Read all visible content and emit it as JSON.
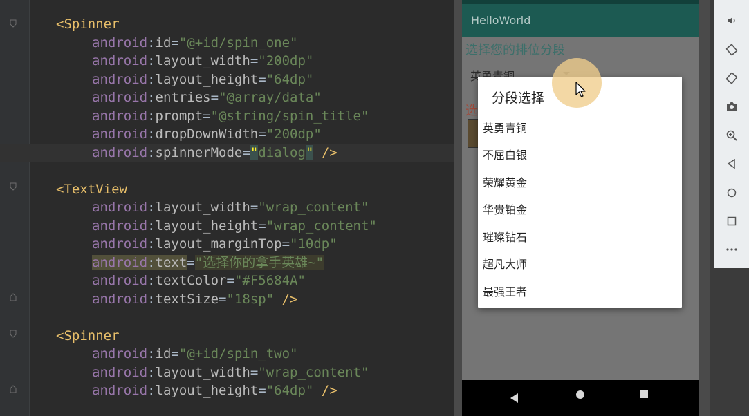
{
  "editor": {
    "lines": [
      {
        "kind": "open",
        "tag": "<Spinner"
      },
      {
        "kind": "attr",
        "ns": "android",
        "name": "id",
        "value": "\"@+id/spin_one\""
      },
      {
        "kind": "attr",
        "ns": "android",
        "name": "layout_width",
        "value": "\"200dp\""
      },
      {
        "kind": "attr",
        "ns": "android",
        "name": "layout_height",
        "value": "\"64dp\""
      },
      {
        "kind": "attr",
        "ns": "android",
        "name": "entries",
        "value": "\"@array/data\""
      },
      {
        "kind": "attr",
        "ns": "android",
        "name": "prompt",
        "value": "\"@string/spin_title\""
      },
      {
        "kind": "attr",
        "ns": "android",
        "name": "dropDownWidth",
        "value": "\"200dp\""
      },
      {
        "kind": "attr",
        "ns": "android",
        "name": "spinnerMode",
        "q1": "\"",
        "value": "dialog",
        "q2": "\"",
        "end": " />"
      },
      {
        "kind": "blank"
      },
      {
        "kind": "open",
        "tag": "<TextView"
      },
      {
        "kind": "attr",
        "ns": "android",
        "name": "layout_width",
        "value": "\"wrap_content\""
      },
      {
        "kind": "attr",
        "ns": "android",
        "name": "layout_height",
        "value": "\"wrap_content\""
      },
      {
        "kind": "attr",
        "ns": "android",
        "name": "layout_marginTop",
        "value": "\"10dp\""
      },
      {
        "kind": "attr",
        "ns": "android",
        "name": "text",
        "value": "\"选择你的拿手英雄~\""
      },
      {
        "kind": "attr",
        "ns": "android",
        "name": "textColor",
        "value": "\"#F5684A\""
      },
      {
        "kind": "attr",
        "ns": "android",
        "name": "textSize",
        "value": "\"18sp\"",
        "end": " />"
      },
      {
        "kind": "blank"
      },
      {
        "kind": "open",
        "tag": "<Spinner"
      },
      {
        "kind": "attr",
        "ns": "android",
        "name": "id",
        "value": "\"@+id/spin_two\""
      },
      {
        "kind": "attr",
        "ns": "android",
        "name": "layout_width",
        "value": "\"wrap_content\""
      },
      {
        "kind": "attr",
        "ns": "android",
        "name": "layout_height",
        "value": "\"64dp\"",
        "end": " />"
      }
    ],
    "colon": ":",
    "equals": "="
  },
  "app": {
    "title": "HelloWorld",
    "prompt_one": "选择您的排位分段",
    "spinner_one_value": "英勇青铜",
    "prompt_two": "选"
  },
  "dialog": {
    "title": "分段选择",
    "items": [
      "英勇青铜",
      "不屈白银",
      "荣耀黄金",
      "华贵铂金",
      "璀璨钻石",
      "超凡大师",
      "最强王者"
    ]
  },
  "colors": {
    "editor_bg": "#2b2b2b",
    "tag": "#e8bf6a",
    "namespace": "#9876aa",
    "string": "#6a8759",
    "app_bar": "#1c5a52",
    "accent_text": "#3c6f6a",
    "touch_indicator": "#f0cd8c"
  },
  "toolbar": {
    "icons": [
      "volume-icon",
      "rotate-left-icon",
      "rotate-right-icon",
      "camera-icon",
      "zoom-icon",
      "back-icon",
      "home-icon",
      "overview-icon",
      "more-icon"
    ]
  }
}
